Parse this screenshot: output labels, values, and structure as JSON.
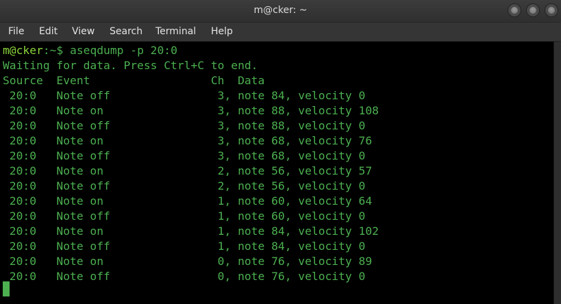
{
  "window": {
    "title": "m@cker: ~"
  },
  "menu": [
    "File",
    "Edit",
    "View",
    "Search",
    "Terminal",
    "Help"
  ],
  "terminal": {
    "prompt_user": "m@cker",
    "prompt_path": ":~$ ",
    "command": "aseqdump -p 20:0",
    "status": "Waiting for data. Press Ctrl+C to end.",
    "header": "Source  Event                  Ch  Data",
    "rows": [
      " 20:0   Note off                3, note 84, velocity 0",
      " 20:0   Note on                 3, note 88, velocity 108",
      " 20:0   Note off                3, note 88, velocity 0",
      " 20:0   Note on                 3, note 68, velocity 76",
      " 20:0   Note off                3, note 68, velocity 0",
      " 20:0   Note on                 2, note 56, velocity 57",
      " 20:0   Note off                2, note 56, velocity 0",
      " 20:0   Note on                 1, note 60, velocity 64",
      " 20:0   Note off                1, note 60, velocity 0",
      " 20:0   Note on                 1, note 84, velocity 102",
      " 20:0   Note off                1, note 84, velocity 0",
      " 20:0   Note on                 0, note 76, velocity 89",
      " 20:0   Note off                0, note 76, velocity 0"
    ]
  },
  "colors": {
    "terminal_text": "#4caf50",
    "prompt_user": "#8bd43a",
    "background": "#000000"
  }
}
